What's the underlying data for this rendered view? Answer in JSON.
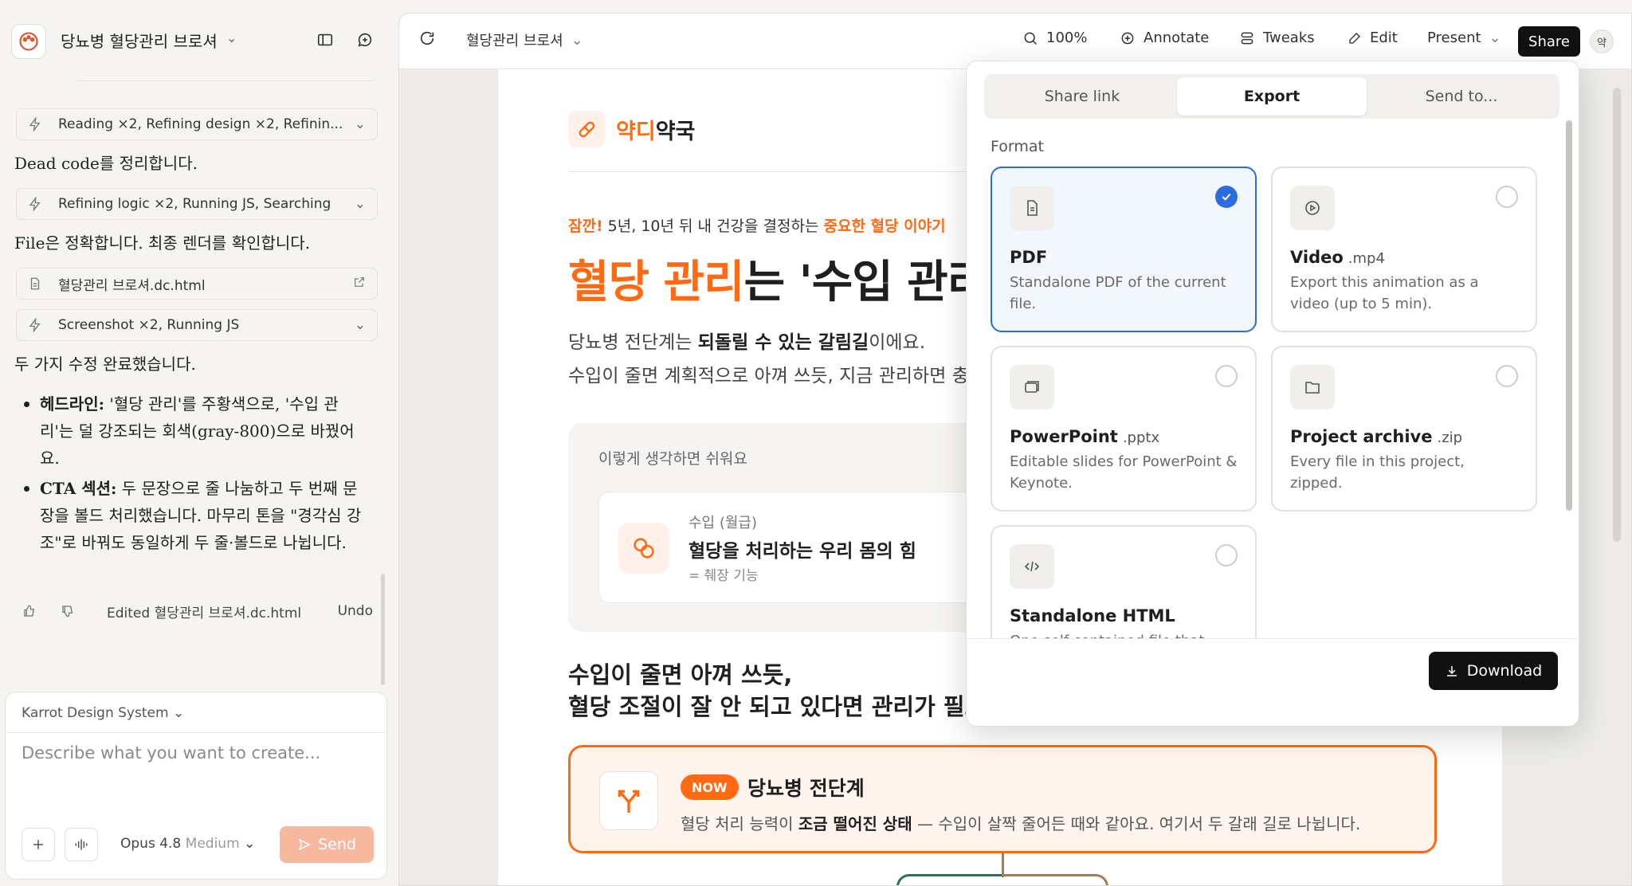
{
  "sidebar": {
    "project_title": "당뇨병 혈당관리 브로셔",
    "chips": [
      {
        "label": "Reading ×2, Refining design ×2, Refinin..."
      },
      {
        "label": "Refining logic ×2, Running JS, Searching"
      },
      {
        "label": "혈당관리 브로셔.dc.html"
      },
      {
        "label": "Screenshot ×2, Running JS"
      }
    ],
    "messages": [
      "Dead code를 정리합니다.",
      "File은 정확합니다. 최종 렌더를 확인합니다.",
      "두 가지 수정 완료했습니다."
    ],
    "bullets": [
      {
        "bold": "헤드라인:",
        "text": " '혈당 관리'를 주황색으로, '수입 관리'는 덜 강조되는 회색(gray-800)으로 바꿨어요."
      },
      {
        "bold": "CTA 섹션:",
        "text": " 두 문장으로 줄 나눔하고 두 번째 문장을 볼드 처리했습니다. 마무리 톤을 \"경각심 강조\"로 바꿔도 동일하게 두 줄·볼드로 나뉩니다."
      }
    ],
    "edited_label": "Edited 혈당관리 브로셔.dc.html",
    "undo_label": "Undo",
    "composer": {
      "design_system": "Karrot Design System",
      "placeholder": "Describe what you want to create...",
      "model": "Opus 4.8",
      "effort": "Medium",
      "send_label": "Send"
    }
  },
  "topbar": {
    "file_title": "혈당관리 브로셔",
    "zoom": "100%",
    "annotate_label": "Annotate",
    "tweaks_label": "Tweaks",
    "edit_label": "Edit",
    "present_label": "Present",
    "share_label": "Share",
    "avatar_initial": "약"
  },
  "doc": {
    "brand_prefix": "약디",
    "brand_suffix": "약국",
    "kicker_lead": "잠깐!",
    "kicker_mid": " 5년, 10년 뒤 내 건강을 결정하는 ",
    "kicker_tail": "중요한 혈당 이야기",
    "headline_orange": "혈당 관리",
    "headline_rest": "는 '수입 관리'와 같아요",
    "lead_1a": "당뇨병 전단계는 ",
    "lead_1b": "되돌릴 수 있는 갈림길",
    "lead_1c": "이에요.",
    "lead_2": "수입이 줄면 계획적으로 아껴 쓰듯, 지금 관리하면 충분히 되돌릴 수 있어요.",
    "think_label": "이렇게 생각하면 쉬워요",
    "think_small": "수입 (월급)",
    "think_title": "혈당을 처리하는 우리 몸의 힘",
    "think_sub": "= 췌장 기능",
    "section_title_1": "수입이 줄면 아껴 쓰듯,",
    "section_title_2": "혈당 조절이 잘 안 되고 있다면 관리가 필요해요",
    "now_badge": "NOW",
    "now_title": "당뇨병 전단계",
    "now_desc_a": "혈당 처리 능력이 ",
    "now_desc_b": "조금 떨어진 상태",
    "now_desc_c": " — 수입이 살짝 줄어든 때와 같아요. 여기서 두 갈래 길로 나뉩니다."
  },
  "export": {
    "tabs": [
      "Share link",
      "Export",
      "Send to..."
    ],
    "active_tab": "Export",
    "format_label": "Format",
    "formats": [
      {
        "name": "PDF",
        "ext": "",
        "desc": "Standalone PDF of the current file.",
        "selected": true,
        "icon": "document-icon"
      },
      {
        "name": "Video",
        "ext": ".mp4",
        "desc": "Export this animation as a video (up to 5 min).",
        "selected": false,
        "icon": "play-icon"
      },
      {
        "name": "PowerPoint",
        "ext": ".pptx",
        "desc": "Editable slides for PowerPoint & Keynote.",
        "selected": false,
        "icon": "slides-icon"
      },
      {
        "name": "Project archive",
        "ext": ".zip",
        "desc": "Every file in this project, zipped.",
        "selected": false,
        "icon": "folder-icon"
      },
      {
        "name": "Standalone HTML",
        "ext": "",
        "desc": "One self-contained file that",
        "selected": false,
        "icon": "code-icon"
      }
    ],
    "download_label": "Download"
  },
  "colors": {
    "accent_orange": "#ff6a13",
    "select_blue": "#2d6cdf",
    "send_disabled": "#f7b8a0"
  }
}
